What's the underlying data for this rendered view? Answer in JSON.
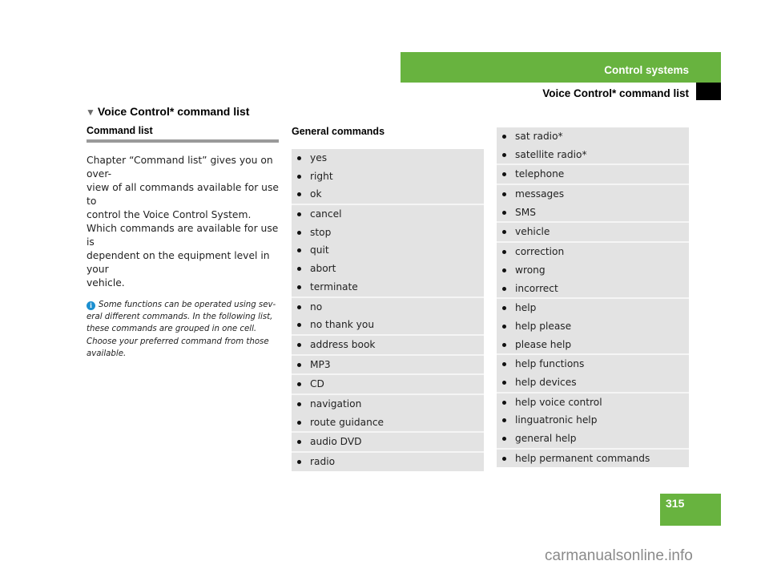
{
  "header": {
    "section": "Control systems",
    "subsection": "Voice Control* command list",
    "accent_color": "#68b33f"
  },
  "main_heading": {
    "icon": "triangle-down-icon",
    "text": "Voice Control* command list"
  },
  "left_column": {
    "sub_heading": "Command list",
    "body": [
      "Chapter “Command list” gives you on over-",
      "view of all commands available for use to",
      "control the Voice Control System.",
      "Which commands are available for use is",
      "dependent on the equipment level in your",
      "vehicle."
    ],
    "note_icon": "info-icon",
    "note": [
      "Some functions can be operated using sev-",
      "eral different commands. In the following list,",
      "these commands are grouped in one cell.",
      "Choose your preferred command from those",
      "available."
    ]
  },
  "general_commands": {
    "heading": "General commands",
    "table1": [
      [
        "yes",
        "right",
        "ok"
      ],
      [
        "cancel",
        "stop",
        "quit",
        "abort",
        "terminate"
      ],
      [
        "no",
        "no thank you"
      ],
      [
        "address book"
      ],
      [
        "MP3"
      ],
      [
        "CD"
      ],
      [
        "navigation",
        "route guidance"
      ],
      [
        "audio DVD"
      ],
      [
        "radio"
      ]
    ],
    "table2": [
      [
        "sat radio*",
        "satellite radio*"
      ],
      [
        "telephone"
      ],
      [
        "messages",
        "SMS"
      ],
      [
        "vehicle"
      ],
      [
        "correction",
        "wrong",
        "incorrect"
      ],
      [
        "help",
        "help please",
        "please help"
      ],
      [
        "help functions",
        "help devices"
      ],
      [
        "help voice control",
        "linguatronic help",
        "general help"
      ],
      [
        "help permanent commands"
      ]
    ]
  },
  "footer": {
    "page_number": "315",
    "watermark": "carmanualsonline.info"
  }
}
